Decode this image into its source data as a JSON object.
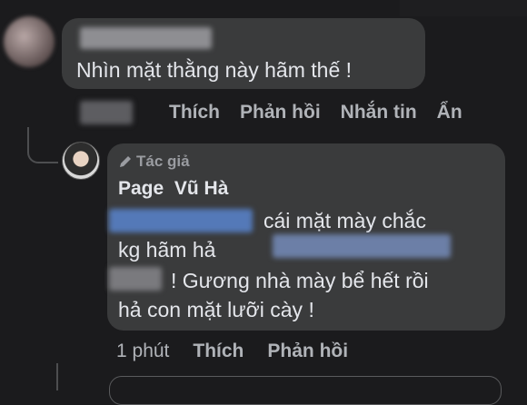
{
  "comment": {
    "text": "Nhìn mặt thằng này hãm thế !",
    "actions": [
      "Thích",
      "Phản hồi",
      "Nhắn tin",
      "Ẩn"
    ]
  },
  "reply": {
    "author_badge": "Tác giả",
    "author_name": "Page  Vũ Hà",
    "line1": "cái mặt mày chắc",
    "line2": "kg hãm hả",
    "line3": "! Gương nhà mày bể hết rồi",
    "line4": "hả con mặt lưỡi cày !",
    "time": "1 phút",
    "like": "Thích",
    "reply": "Phản hồi"
  }
}
